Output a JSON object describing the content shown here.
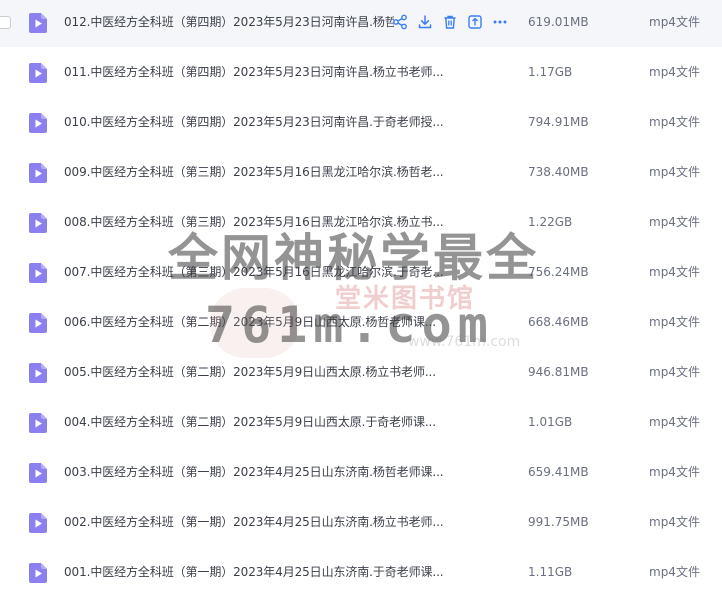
{
  "files": [
    {
      "name": "012.中医经方全科班（第四期）2023年5月23日河南许昌.杨哲",
      "size": "619.01MB",
      "type": "mp4文件"
    },
    {
      "name": "011.中医经方全科班（第四期）2023年5月23日河南许昌.杨立书老师...",
      "size": "1.17GB",
      "type": "mp4文件"
    },
    {
      "name": "010.中医经方全科班（第四期）2023年5月23日河南许昌.于奇老师授...",
      "size": "794.91MB",
      "type": "mp4文件"
    },
    {
      "name": "009.中医经方全科班（第三期）2023年5月16日黑龙江哈尔滨.杨哲老...",
      "size": "738.40MB",
      "type": "mp4文件"
    },
    {
      "name": "008.中医经方全科班（第三期）2023年5月16日黑龙江哈尔滨.杨立书...",
      "size": "1.22GB",
      "type": "mp4文件"
    },
    {
      "name": "007.中医经方全科班（第三期）2023年5月16日黑龙江哈尔滨.于奇老...",
      "size": "756.24MB",
      "type": "mp4文件"
    },
    {
      "name": "006.中医经方全科班（第二期）2023年5月9日山西太原.杨哲老师课...",
      "size": "668.46MB",
      "type": "mp4文件"
    },
    {
      "name": "005.中医经方全科班（第二期）2023年5月9日山西太原.杨立书老师...",
      "size": "946.81MB",
      "type": "mp4文件"
    },
    {
      "name": "004.中医经方全科班（第二期）2023年5月9日山西太原.于奇老师课...",
      "size": "1.01GB",
      "type": "mp4文件"
    },
    {
      "name": "003.中医经方全科班（第一期）2023年4月25日山东济南.杨哲老师课...",
      "size": "659.41MB",
      "type": "mp4文件"
    },
    {
      "name": "002.中医经方全科班（第一期）2023年4月25日山东济南.杨立书老师...",
      "size": "991.75MB",
      "type": "mp4文件"
    },
    {
      "name": "001.中医经方全科班（第一期）2023年4月25日山东济南.于奇老师课...",
      "size": "1.11GB",
      "type": "mp4文件"
    }
  ],
  "hovered_row_index": 0,
  "row_actions": [
    "share-icon",
    "download-icon",
    "delete-icon",
    "more-info-icon",
    "more-icon"
  ],
  "watermark": {
    "line1": "全网神秘学最全",
    "line2": "761m.com",
    "brand": "堂米图书馆",
    "url": "www.761m.com"
  },
  "colors": {
    "icon_purple": "#8b80f0",
    "action_blue": "#3a7ef5",
    "text": "#3b3f4a",
    "meta_text": "#6b7080",
    "hover_bg": "#f5f6fa"
  }
}
